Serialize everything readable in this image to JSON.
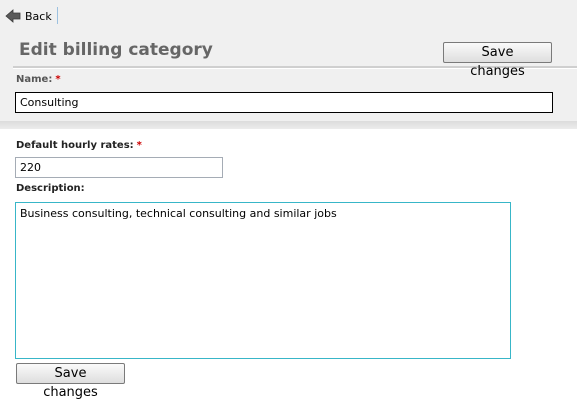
{
  "nav": {
    "back_label": "Back"
  },
  "page": {
    "title": "Edit billing category"
  },
  "form": {
    "name_label": "Name:",
    "name_value": "Consulting",
    "required_mark": "*",
    "rate_label": "Default hourly rates:",
    "rate_value": "220",
    "description_label": "Description:",
    "description_value": "Business consulting, technical consulting and similar jobs"
  },
  "buttons": {
    "save_label": "Save changes"
  },
  "icons": {
    "back": "back-arrow-icon"
  },
  "colors": {
    "required": "#cc0000",
    "focus_border": "#38b6c8",
    "title": "#666666"
  }
}
